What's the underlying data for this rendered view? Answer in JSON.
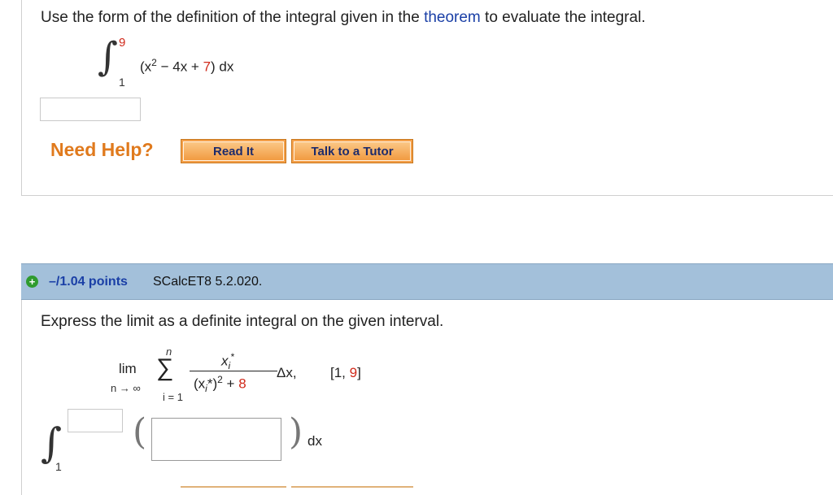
{
  "problem1": {
    "prompt_before": "Use the form of the definition of the integral given in the",
    "prompt_link": "theorem",
    "prompt_after": "to evaluate the integral.",
    "integral_upper": "9",
    "integral_lower": "1",
    "integrand_a": "(x",
    "integrand_exp": "2",
    "integrand_b": " − 4x + ",
    "integrand_const": "7",
    "integrand_c": ") dx",
    "answer_value": ""
  },
  "help": {
    "label": "Need Help?",
    "read_it": "Read It",
    "talk_to_tutor": "Talk to a Tutor"
  },
  "problem2_header": {
    "points": "–/1.04 points",
    "source": "SCalcET8 5.2.020."
  },
  "problem2": {
    "prompt": "Express the limit as a definite integral on the given interval.",
    "lim": "lim",
    "lim_sub": "n → ∞",
    "sigma_top": "n",
    "sigma": "∑",
    "sigma_sub": "i = 1",
    "numerator": "x",
    "numerator_sub": "i",
    "numerator_sup": "*",
    "den_a": "(x",
    "den_sub": "i",
    "den_b": "*)",
    "den_exp": "2",
    "den_c": " + ",
    "den_const": "8",
    "delta": "Δx,",
    "interval_open": "[1, ",
    "interval_end": "9",
    "interval_close": "]",
    "integral_lower": "1",
    "upper_value": "",
    "integrand_value": "",
    "dx": "dx"
  },
  "colors": {
    "link": "#1a3fa6",
    "highlight": "#d0291a",
    "help_orange": "#e07a1d",
    "header_blue": "#a3c0da"
  }
}
